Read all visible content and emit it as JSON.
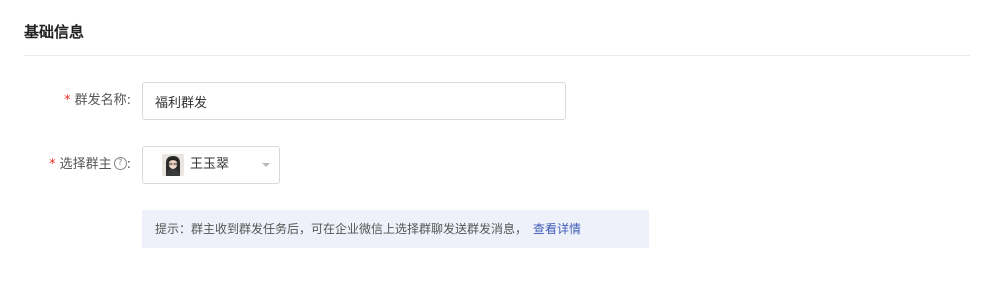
{
  "section": {
    "title": "基础信息"
  },
  "form": {
    "name_field": {
      "required_mark": "*",
      "label": "群发名称:",
      "value": "福利群发"
    },
    "owner_field": {
      "required_mark": "*",
      "label": "选择群主",
      "help_icon": "question-circle-icon",
      "help_symbol": "?",
      "label_suffix": ":",
      "selected_owner": "王玉翠",
      "avatar_icon": "user-avatar-photo",
      "dropdown_icon": "caret-down-icon"
    }
  },
  "tip": {
    "text": "提示：群主收到群发任务后，可在企业微信上选择群聊发送群发消息，",
    "link_text": "查看详情"
  },
  "colors": {
    "required": "#e5322d",
    "link": "#3f5bb8",
    "tip_background": "#eef1f9",
    "border": "#d9d9d9"
  }
}
